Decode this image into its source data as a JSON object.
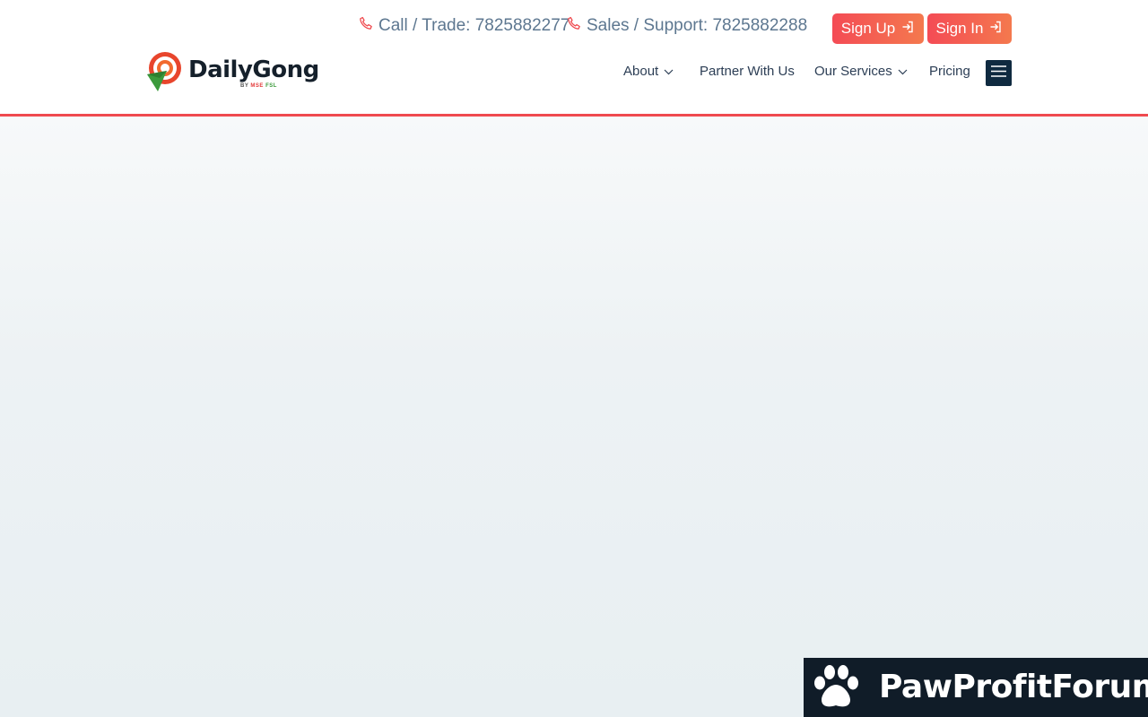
{
  "topbar": {
    "call_label": "Call / Trade: 7825882277",
    "sales_label": "Sales / Support: 7825882288",
    "signup_label": "Sign Up",
    "signin_label": "Sign In"
  },
  "logo": {
    "name": "DailyGong",
    "tagline_prefix": "BY ",
    "tagline_mse": "MSE",
    "tagline_fsl": " FSL"
  },
  "nav": {
    "items": [
      {
        "label": "About",
        "has_dropdown": true
      },
      {
        "label": "Partner With Us",
        "has_dropdown": false
      },
      {
        "label": "Our Services",
        "has_dropdown": true
      },
      {
        "label": "Pricing",
        "has_dropdown": false
      }
    ],
    "menu_icon": "hamburger-icon"
  },
  "watermark": {
    "text": "PawProfitForum",
    "icon": "paw-icon"
  },
  "colors": {
    "accent": "#ef4a4f",
    "button_gradient_start": "#f44b55",
    "button_gradient_end": "#f4794e",
    "nav_text": "#2c3e55",
    "menu_button": "#0f2a40",
    "watermark_bg": "#101c28"
  }
}
